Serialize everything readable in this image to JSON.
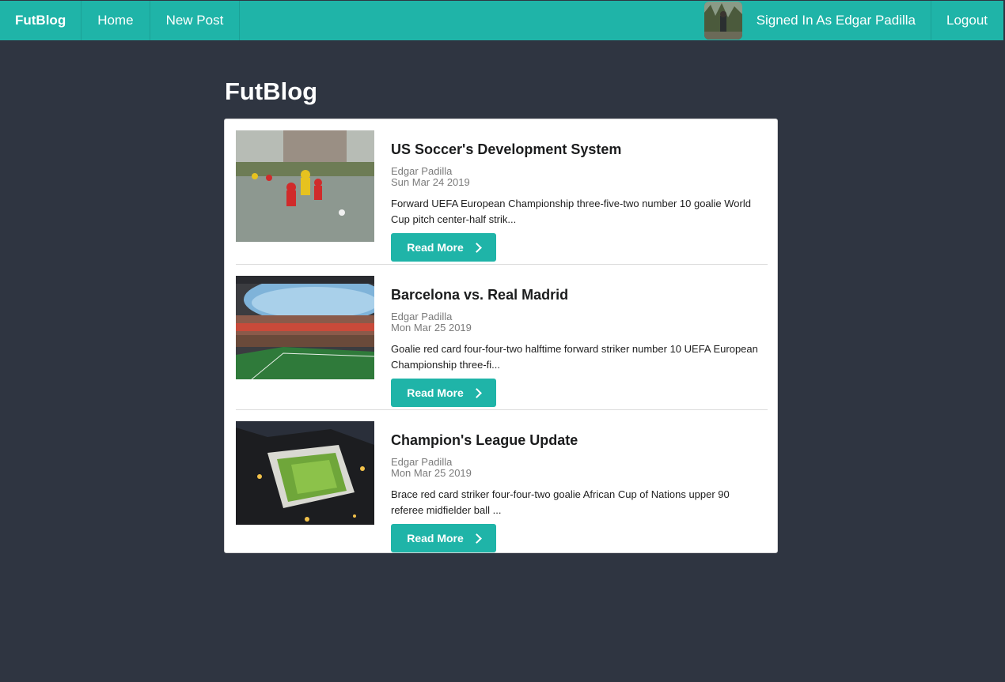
{
  "nav": {
    "brand": "FutBlog",
    "home": "Home",
    "new_post": "New Post",
    "signed_in": "Signed In As Edgar Padilla",
    "logout": "Logout",
    "accent": "#1fb4a8"
  },
  "page": {
    "title": "FutBlog",
    "background": "#2f3541"
  },
  "posts": [
    {
      "title": "US Soccer's Development System",
      "author": "Edgar Padilla",
      "date": "Sun Mar 24 2019",
      "excerpt": "Forward UEFA European Championship three-five-two number 10 goalie World Cup pitch center-half strik...",
      "button": "Read More",
      "image": "youth-soccer-match-photo"
    },
    {
      "title": "Barcelona vs. Real Madrid",
      "author": "Edgar Padilla",
      "date": "Mon Mar 25 2019",
      "excerpt": "Goalie red card four-four-two halftime forward striker number 10 UEFA European Championship three-fi...",
      "button": "Read More",
      "image": "stadium-interior-photo"
    },
    {
      "title": "Champion's League Update",
      "author": "Edgar Padilla",
      "date": "Mon Mar 25 2019",
      "excerpt": "Brace red card striker four-four-two goalie African Cup of Nations upper 90 referee midfielder ball ...",
      "button": "Read More",
      "image": "stadium-aerial-night-photo"
    }
  ]
}
